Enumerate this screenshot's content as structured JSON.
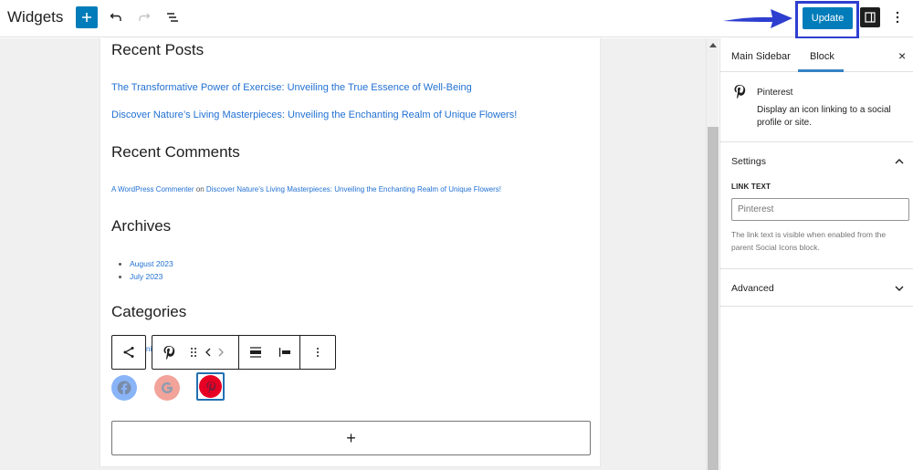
{
  "header": {
    "title": "Widgets",
    "update_label": "Update",
    "icons": {
      "inserter": "plus-icon",
      "undo": "undo-icon",
      "redo": "redo-icon",
      "list_view": "list-view-icon",
      "sidebar_toggle": "sidebar-toggle-icon",
      "more": "more-vertical-icon"
    },
    "annotation": "blue-arrow-pointing-to-update"
  },
  "canvas": {
    "recent_posts": {
      "heading": "Recent Posts",
      "posts": [
        "The Transformative Power of Exercise: Unveiling the True Essence of Well-Being",
        "Discover Nature’s Living Masterpieces: Unveiling the Enchanting Realm of Unique Flowers!"
      ]
    },
    "recent_comments": {
      "heading": "Recent Comments",
      "author": "A WordPress Commenter",
      "connector": " on ",
      "post": "Discover Nature’s Living Masterpieces: Unveiling the Enchanting Realm of Unique Flowers!"
    },
    "archives": {
      "heading": "Archives",
      "items": [
        "August 2023",
        "July 2023"
      ]
    },
    "categories": {
      "heading": "Categories",
      "partial_text": "ni"
    },
    "block_toolbar": {
      "parent_icon": "share-icon",
      "block_icon": "pinterest-icon",
      "drag": "drag-handle-icon",
      "move_left": "‹",
      "move_right": "›",
      "more": "⋮"
    },
    "social_icons": [
      {
        "name": "Facebook",
        "color": "#8ab4f8"
      },
      {
        "name": "Google",
        "color": "#f2a39a"
      },
      {
        "name": "Pinterest",
        "color": "#e60023",
        "selected": true
      }
    ],
    "add_block_label": "+"
  },
  "sidebar": {
    "tabs": [
      {
        "label": "Main Sidebar",
        "active": false
      },
      {
        "label": "Block",
        "active": true
      }
    ],
    "close_label": "×",
    "block": {
      "title": "Pinterest",
      "description": "Display an icon linking to a social profile or site."
    },
    "settings": {
      "title": "Settings",
      "link_text_label": "LINK TEXT",
      "link_text_placeholder": "Pinterest",
      "link_text_value": "",
      "help": "The link text is visible when enabled from the parent Social Icons block."
    },
    "advanced": {
      "title": "Advanced"
    }
  },
  "colors": {
    "accent": "#007cba",
    "link": "#2271d3",
    "highlight_box": "#2e3fd0"
  }
}
